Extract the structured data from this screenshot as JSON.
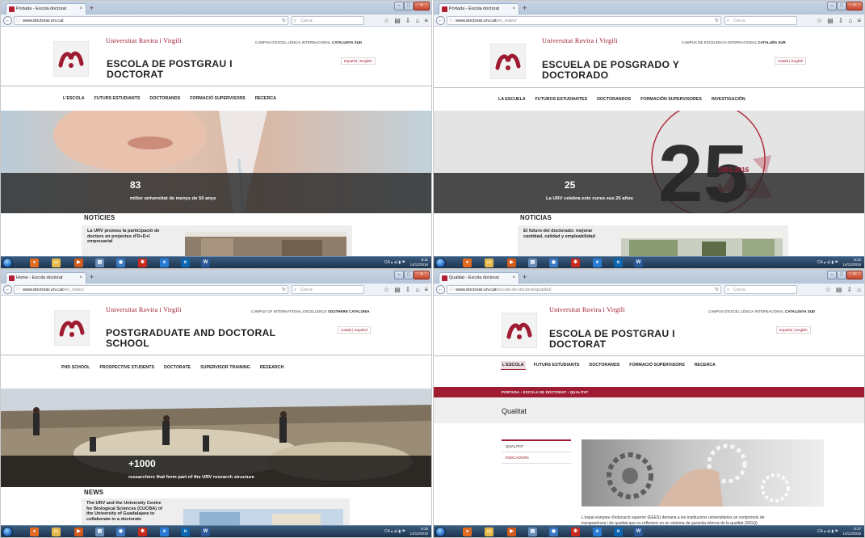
{
  "panels": [
    {
      "tab_title": "Portada - Escola doctorat",
      "url_host": "www.doctorat.urv.cat",
      "url_path": "",
      "search_placeholder": "Cerca",
      "university": "Universitat Rovira i Virgili",
      "campus_prefix": "CAMPUS D'EXCEL·LÈNCIA INTERNACIONAL",
      "campus_region": "CATALUNYA SUD",
      "title_line1": "ESCOLA DE POSTGRAU I",
      "title_line2": "DOCTORAT",
      "lang_1": "Español",
      "lang_2": "English",
      "menu": [
        "L'ESCOLA",
        "FUTURS ESTUDIANTS",
        "DOCTORANDS",
        "FORMACIÓ SUPERVISORS",
        "RECERCA"
      ],
      "hero_number": "83",
      "hero_caption": "millor universitat de menys de 50 anys",
      "news_heading": "NOTÍCIES",
      "news_line1": "La URV promou la participació de",
      "news_line2": "doctors en projectes d'R+D+I",
      "news_line3": "empresarial",
      "clock_time": "8:11",
      "clock_date": "14/12/2016",
      "tray_lang": "CA"
    },
    {
      "tab_title": "Portada - Escola doctorat",
      "url_host": "www.doctorat.urv.cat",
      "url_path": "/es_index/",
      "search_placeholder": "Cerca",
      "university": "Universitat Rovira i Virgili",
      "campus_prefix": "CAMPUS DE EXCELENCIA INTERNACIONAL",
      "campus_region": "CATALUÑA SUR",
      "title_line1": "ESCUELA DE POSGRADO Y",
      "title_line2": "DOCTORADO",
      "lang_1": "Català",
      "lang_2": "English",
      "menu": [
        "LA ESCUELA",
        "FUTUROS ESTUDIANTES",
        "DOCTORANDOS",
        "FORMACIÓN SUPERVISORES",
        "INVESTIGACIÓN"
      ],
      "hero_number": "25",
      "hero_caption": "La URV celebra este curso sus 25 años",
      "hero_badge": "1991-2016",
      "news_heading": "NOTICIAS",
      "news_line1": "El futuro del doctorado: mejorar",
      "news_line2": "cantidad, calidad y empleabilidad",
      "news_line3": "",
      "clock_time": "8:12",
      "clock_date": "14/12/2016",
      "tray_lang": "CA"
    },
    {
      "tab_title": "Home - Escola doctorat",
      "url_host": "www.doctorat.urv.cat",
      "url_path": "/en_index/",
      "search_placeholder": "Cerca",
      "university": "Universitat Rovira i Virgili",
      "campus_prefix": "CAMPUS OF INTERNATIONAL EXCELLENCE",
      "campus_region": "SOUTHERN CATALONIA",
      "title_line1": "POSTGRADUATE AND DOCTORAL",
      "title_line2": "SCHOOL",
      "lang_1": "Català",
      "lang_2": "Español",
      "menu": [
        "PHD SCHOOL",
        "PROSPECTIVE STUDENTS",
        "DOCTORATE",
        "SUPERVISOR TRAINING",
        "RESEARCH"
      ],
      "hero_number": "+1000",
      "hero_caption": "researchers that form part of the URV research structure",
      "news_heading": "NEWS",
      "news_line1": "The URV and the University Centre",
      "news_line2": "for Biological Sciences (CUCBA) of",
      "news_line3": "the University of Guadalajara to",
      "news_line4": "collaborate in a doctorate",
      "clock_time": "8:15",
      "clock_date": "14/12/2016",
      "tray_lang": "CA"
    },
    {
      "tab_title": "Qualitat - Escola doctorat",
      "url_host": "www.doctorat.urv.cat",
      "url_path": "/escola-de-doctorat/qualitat/",
      "search_placeholder": "Cerca",
      "university": "Universitat Rovira i Virgili",
      "campus_prefix": "CAMPUS D'EXCEL·LÈNCIA INTERNACIONAL",
      "campus_region": "CATALUNYA SUD",
      "title_line1": "ESCOLA DE POSTGRAU I",
      "title_line2": "DOCTORAT",
      "lang_1": "Español",
      "lang_2": "English",
      "menu": [
        "L'ESCOLA",
        "FUTURS ESTUDIANTS",
        "DOCTORANDS",
        "FORMACIÓ SUPERVISORS",
        "RECERCA"
      ],
      "breadcrumb": [
        "PORTADA",
        "ESCOLA DE DOCTORAT",
        "QUALITAT"
      ],
      "breadcrumb_sep": "›",
      "page_title": "Qualitat",
      "side_items": [
        "QUALITAT",
        "INDICADORS"
      ],
      "body_line1": "L'espai europeu d'educació superior (EEES) demana a les institucions universitàries un compromís de",
      "body_line2": "transparència i de qualitat que es reflecteix en un sistema de garantia interna de la qualitat (SIGQ).",
      "clock_time": "8:17",
      "clock_date": "14/12/2016",
      "tray_lang": "CA"
    }
  ],
  "colors": {
    "brand": "#9e1b32",
    "text": "#222222",
    "hero_band": "#2e2e2e"
  },
  "icons": {
    "favicon": "urv-favicon-icon",
    "back": "back-arrow-icon",
    "bookmark": "star-icon",
    "library": "clipboard-icon",
    "downloads": "download-icon",
    "home": "home-icon",
    "menu": "hamburger-icon"
  }
}
